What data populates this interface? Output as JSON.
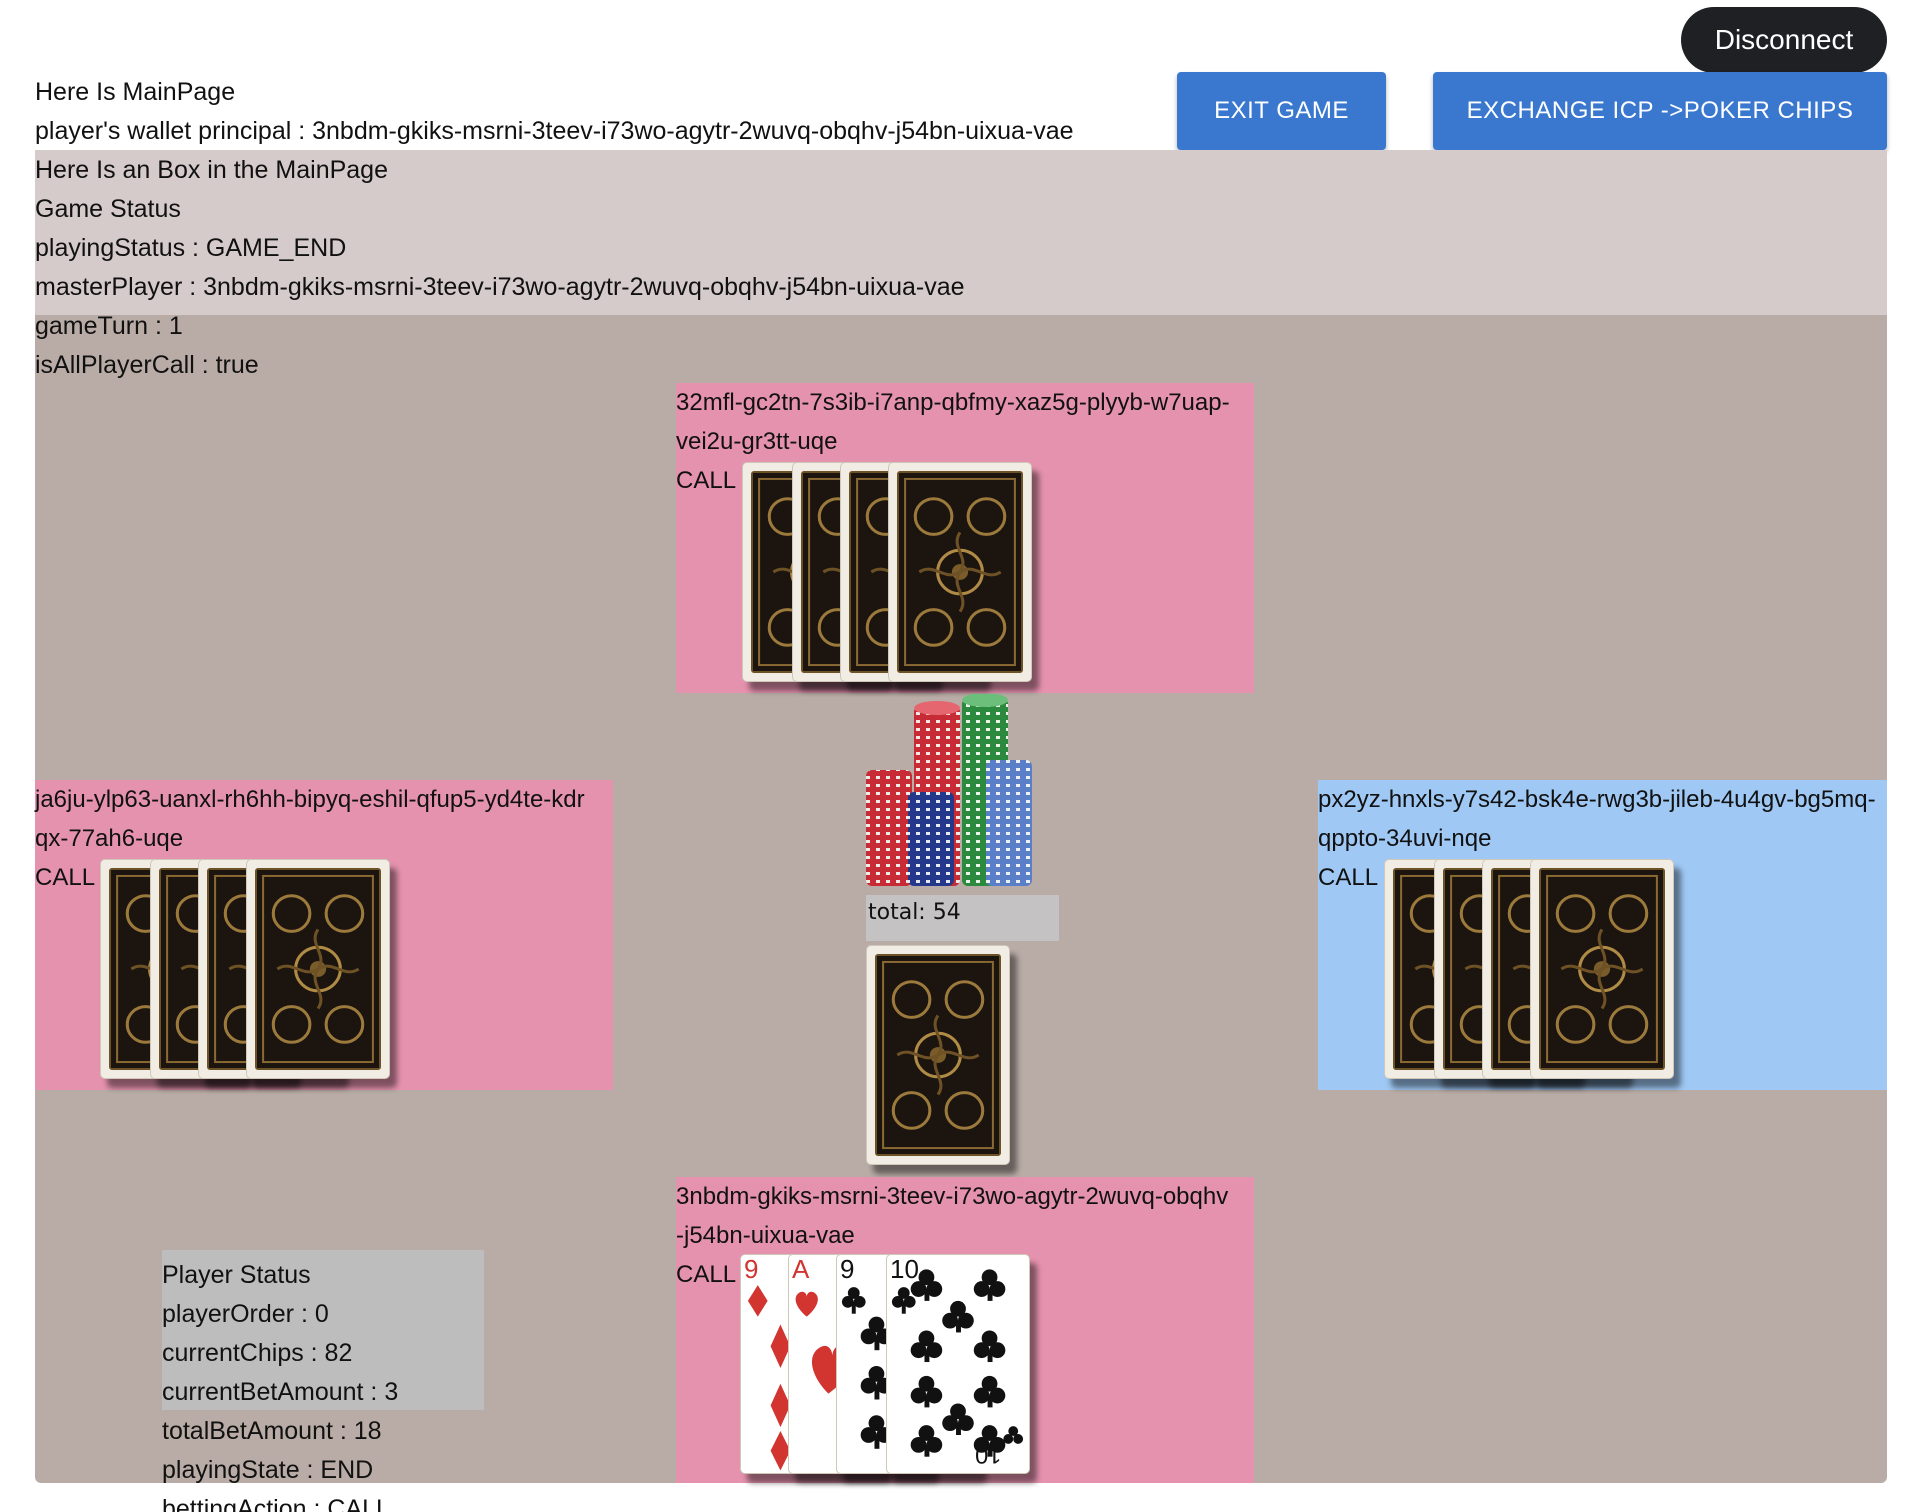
{
  "header": {
    "title": "Here Is MainPage",
    "wallet_label": "player's wallet principal : 3nbdm-gkiks-msrni-3teev-i73wo-agytr-2wuvq-obqhv-j54bn-uixua-vae",
    "disconnect": "Disconnect",
    "exit_game": "EXIT GAME",
    "exchange": "EXCHANGE ICP ->POKER CHIPS"
  },
  "game_status": {
    "box_title": "Here Is an Box in the MainPage",
    "heading": "Game Status",
    "playing_status": "playingStatus : GAME_END",
    "master_player": "masterPlayer : 3nbdm-gkiks-msrni-3teev-i73wo-agytr-2wuvq-obqhv-j54bn-uixua-vae",
    "game_turn": "gameTurn : 1",
    "all_call": "isAllPlayerCall : true"
  },
  "players": {
    "top": {
      "name": "32mfl-gc2tn-7s3ib-i7anp-qbfmy-xaz5g-plyyb-w7uap-vei2u-gr3tt-uqe",
      "action": "CALL"
    },
    "left": {
      "name": "ja6ju-ylp63-uanxl-rh6hh-bipyq-eshil-qfup5-yd4te-kdrqx-77ah6-uqe",
      "action": "CALL"
    },
    "right": {
      "name": "px2yz-hnxls-y7s42-bsk4e-rwg3b-jileb-4u4gv-bg5mq-qppto-34uvi-nqe",
      "action": "CALL"
    },
    "bottom": {
      "name": "3nbdm-gkiks-msrni-3teev-i73wo-agytr-2wuvq-obqhv-j54bn-uixua-vae",
      "action": "CALL",
      "cards": [
        {
          "rank": "9",
          "suit": "diamonds",
          "color": "#d2342f"
        },
        {
          "rank": "A",
          "suit": "hearts",
          "color": "#d2342f"
        },
        {
          "rank": "9",
          "suit": "clubs",
          "color": "#111111"
        },
        {
          "rank": "10",
          "suit": "clubs",
          "color": "#111111"
        }
      ]
    }
  },
  "pot": {
    "total": "total: 54"
  },
  "player_status": {
    "heading": "Player Status",
    "order": "playerOrder : 0",
    "chips": "currentChips : 82",
    "bet": "currentBetAmount : 3",
    "total_bet": "totalBetAmount : 18",
    "state": "playingState : END",
    "action": "bettingAction : CALL"
  },
  "colors": {
    "accent_button": "#3a78d0",
    "player_zone_pink": "#e592ae",
    "player_zone_blue": "#9fc8f4",
    "table_bg": "#b9aca6",
    "status_box_bg": "#d5cbca"
  }
}
